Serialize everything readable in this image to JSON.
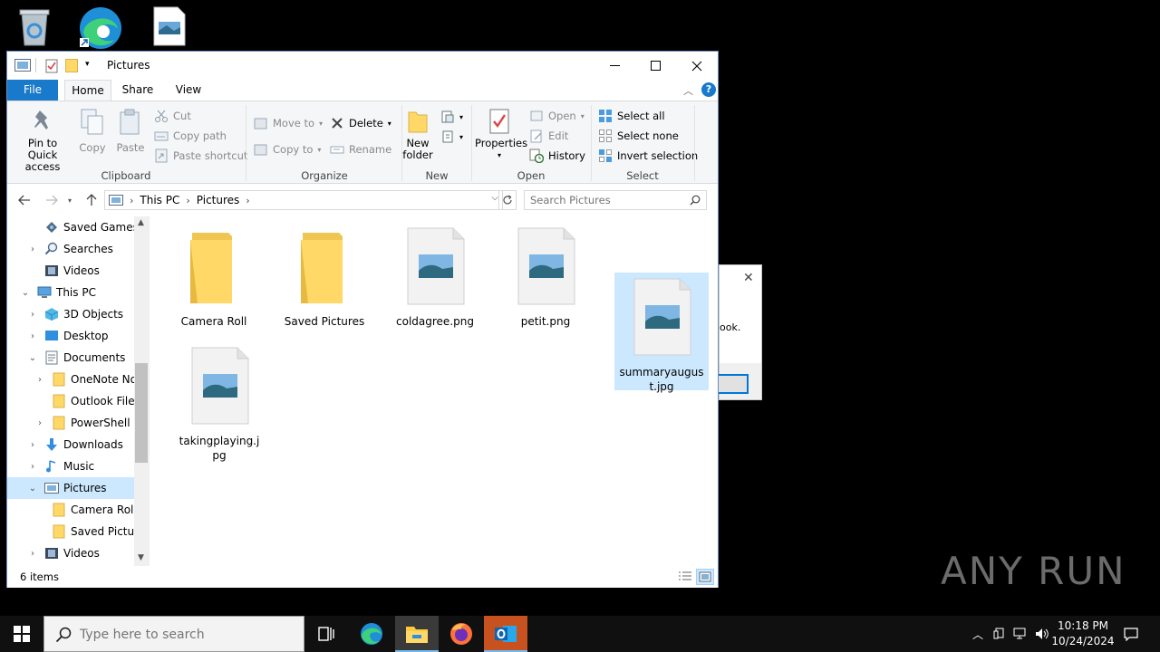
{
  "window": {
    "title": "Pictures"
  },
  "ribbon_tabs": [
    "File",
    "Home",
    "Share",
    "View"
  ],
  "ribbon": {
    "clipboard": {
      "pin": "Pin to Quick access",
      "copy": "Copy",
      "paste": "Paste",
      "cut": "Cut",
      "copy_path": "Copy path",
      "paste_shortcut": "Paste shortcut",
      "label": "Clipboard"
    },
    "organize": {
      "move_to": "Move to",
      "copy_to": "Copy to",
      "delete": "Delete",
      "rename": "Rename",
      "label": "Organize"
    },
    "new": {
      "new_folder": "New folder",
      "label": "New"
    },
    "open": {
      "properties": "Properties",
      "open": "Open",
      "edit": "Edit",
      "history": "History",
      "label": "Open"
    },
    "select": {
      "select_all": "Select all",
      "select_none": "Select none",
      "invert": "Invert selection",
      "label": "Select"
    }
  },
  "address": {
    "crumbs": [
      "This PC",
      "Pictures"
    ]
  },
  "search": {
    "placeholder": "Search Pictures"
  },
  "nav": [
    {
      "label": "Saved Games",
      "icon": "saved-games-icon"
    },
    {
      "label": "Searches",
      "icon": "search-icon"
    },
    {
      "label": "Videos",
      "icon": "videos-icon"
    },
    {
      "label": "This PC",
      "icon": "computer-icon"
    },
    {
      "label": "3D Objects",
      "icon": "3d-objects-icon"
    },
    {
      "label": "Desktop",
      "icon": "desktop-icon"
    },
    {
      "label": "Documents",
      "icon": "documents-icon"
    },
    {
      "label": "OneNote Not",
      "icon": "folder-icon"
    },
    {
      "label": "Outlook Files",
      "icon": "folder-icon"
    },
    {
      "label": "PowerShell",
      "icon": "folder-icon"
    },
    {
      "label": "Downloads",
      "icon": "downloads-icon"
    },
    {
      "label": "Music",
      "icon": "music-icon"
    },
    {
      "label": "Pictures",
      "icon": "pictures-icon"
    },
    {
      "label": "Camera Roll",
      "icon": "folder-icon"
    },
    {
      "label": "Saved Picture",
      "icon": "folder-icon"
    },
    {
      "label": "Videos",
      "icon": "videos-icon"
    }
  ],
  "files": [
    {
      "name": "Camera Roll",
      "type": "folder"
    },
    {
      "name": "Saved Pictures",
      "type": "folder"
    },
    {
      "name": "coldagree.png",
      "type": "image"
    },
    {
      "name": "petit.png",
      "type": "image"
    },
    {
      "name": "summaryaugust.jpg",
      "type": "image",
      "selected": true
    },
    {
      "name": "takingplaying.jpg",
      "type": "image"
    }
  ],
  "status": {
    "count": "6 items"
  },
  "dialog": {
    "text_fragment": "ook."
  },
  "taskbar": {
    "search_placeholder": "Type here to search",
    "time": "10:18 PM",
    "date": "10/24/2024"
  },
  "watermark": "ANY RUN",
  "colors": {
    "accent": "#1979ca",
    "selection": "#cce8ff",
    "folder": "#ffd867",
    "taskbar": "#101010"
  }
}
